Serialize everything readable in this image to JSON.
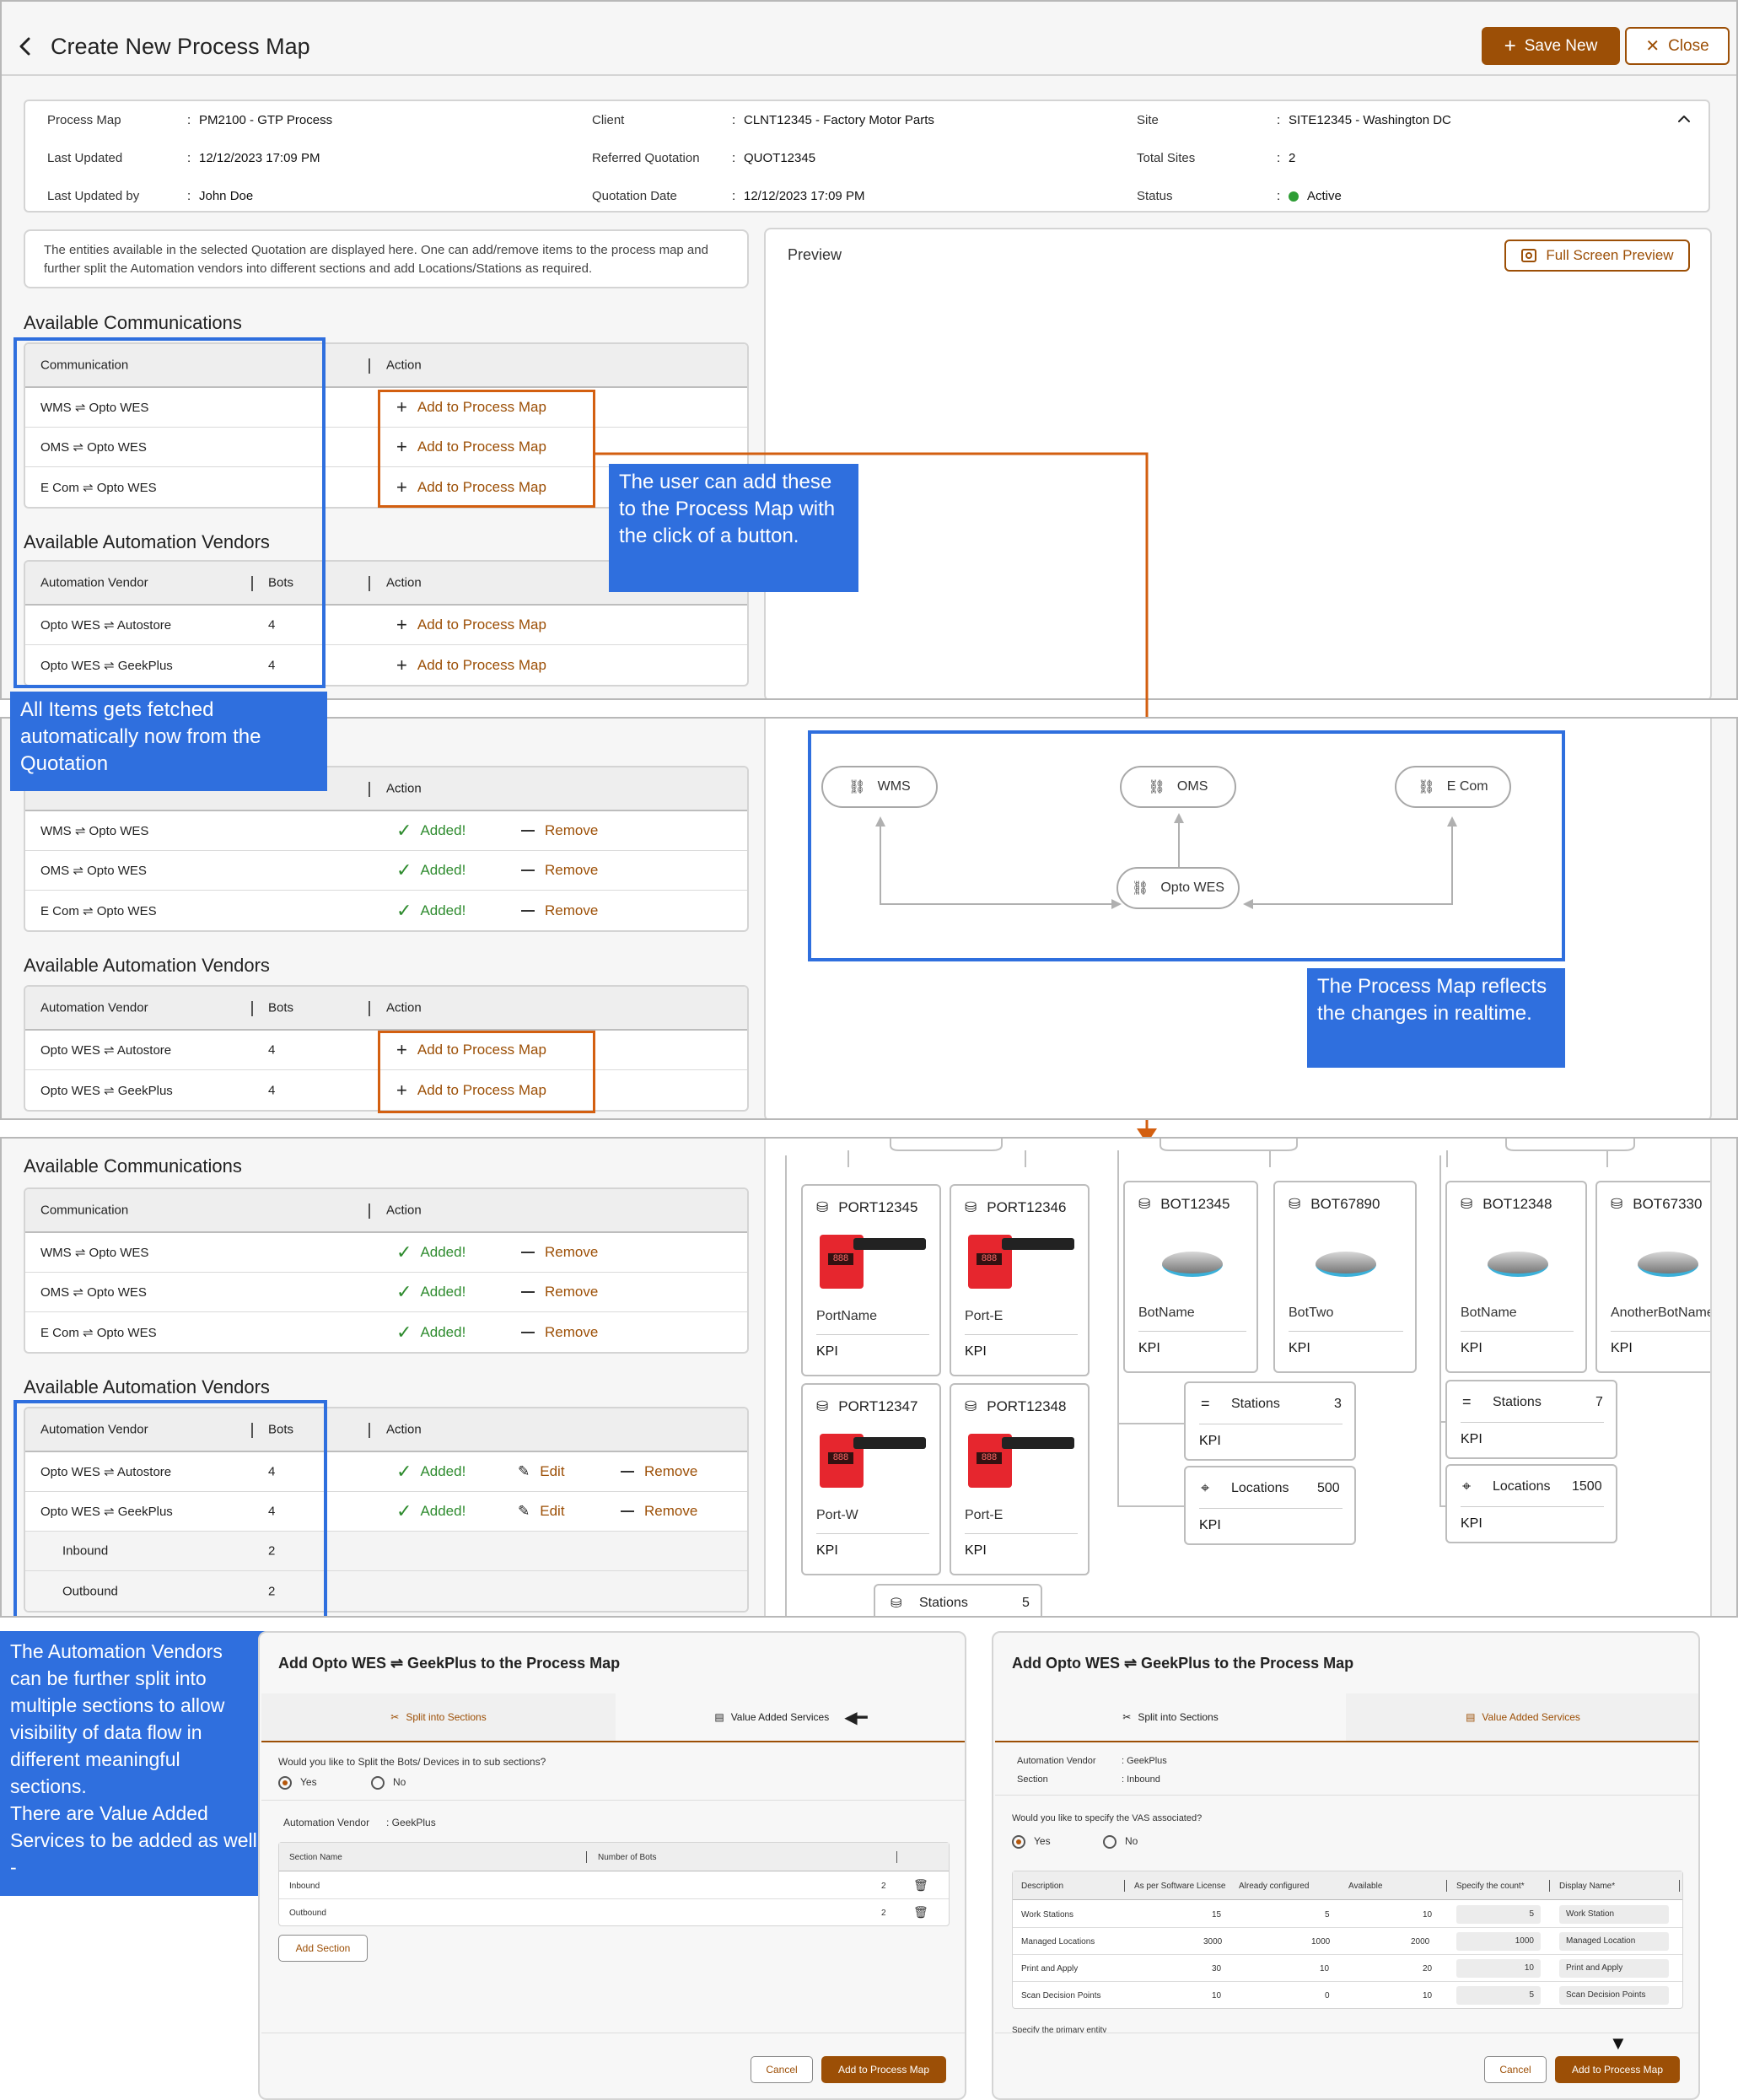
{
  "header": {
    "title": "Create New Process Map",
    "save_label": "Save New",
    "close_label": "Close"
  },
  "info": {
    "process_map_label": "Process Map",
    "process_map_value": "PM2100 - GTP Process",
    "last_updated_label": "Last Updated",
    "last_updated_value": "12/12/2023 17:09 PM",
    "last_updated_by_label": "Last Updated by",
    "last_updated_by_value": "John Doe",
    "client_label": "Client",
    "client_value": "CLNT12345 - Factory Motor Parts",
    "referred_quotation_label": "Referred Quotation",
    "referred_quotation_value": "QUOT12345",
    "quotation_date_label": "Quotation Date",
    "quotation_date_value": "12/12/2023 17:09 PM",
    "site_label": "Site",
    "site_value": "SITE12345 - Washington DC",
    "total_sites_label": "Total Sites",
    "total_sites_value": "2",
    "status_label": "Status",
    "status_value": "Active",
    "colon": ":"
  },
  "note": "The entities available in the selected Quotation are displayed here. One can add/remove items to the process map and further split the Automation vendors into different sections and add Locations/Stations as required.",
  "sections": {
    "available_communications": "Available Communications",
    "available_vendors": "Available Automation Vendors"
  },
  "table": {
    "communication_header": "Communication",
    "action_header": "Action",
    "vendor_header": "Automation Vendor",
    "bots_header": "Bots",
    "add_label": "Add to Process Map",
    "added_label": "Added!",
    "remove_label": "Remove",
    "edit_label": "Edit"
  },
  "communications": [
    "WMS ⇌ Opto WES",
    "OMS ⇌ Opto WES",
    "E Com ⇌ Opto WES"
  ],
  "vendors": [
    {
      "name": "Opto WES ⇌ Autostore",
      "bots": "4"
    },
    {
      "name": "Opto WES ⇌ GeekPlus",
      "bots": "4"
    }
  ],
  "subsections": [
    {
      "name": "Inbound",
      "bots": "2"
    },
    {
      "name": "Outbound",
      "bots": "2"
    }
  ],
  "preview": {
    "title": "Preview",
    "fullscreen_label": "Full Screen Preview"
  },
  "map_nodes": {
    "wms": "WMS",
    "oms": "OMS",
    "ecom": "E Com",
    "opto": "Opto WES"
  },
  "callouts": {
    "add_button": "The user can add these to the Process Map with the click of a button.",
    "fetched": "All Items gets fetched automatically now from the Quotation",
    "realtime": "The Process Map reflects the changes in realtime.",
    "split": "The Automation Vendors can be further split into multiple sections to allow visibility of data flow in different meaningful sections.\nThere are Value Added Services to be added as well -"
  },
  "ports": [
    {
      "id": "PORT12345",
      "name": "PortName",
      "kpi": "KPI",
      "display": "888"
    },
    {
      "id": "PORT12346",
      "name": "Port-E",
      "kpi": "KPI",
      "display": "888"
    },
    {
      "id": "PORT12347",
      "name": "Port-W",
      "kpi": "KPI",
      "display": "888"
    },
    {
      "id": "PORT12348",
      "name": "Port-E",
      "kpi": "KPI",
      "display": "888"
    }
  ],
  "bots_a": [
    {
      "id": "BOT12345",
      "name": "BotName",
      "kpi": "KPI"
    },
    {
      "id": "BOT67890",
      "name": "BotTwo",
      "kpi": "KPI"
    }
  ],
  "bots_b": [
    {
      "id": "BOT12348",
      "name": "BotName",
      "kpi": "KPI"
    },
    {
      "id": "BOT67330",
      "name": "AnotherBotName",
      "kpi": "KPI"
    }
  ],
  "stat_cards": {
    "stations_a": {
      "label": "Stations",
      "value": "3",
      "kpi": "KPI"
    },
    "locations_a": {
      "label": "Locations",
      "value": "500",
      "kpi": "KPI"
    },
    "stations_b": {
      "label": "Stations",
      "value": "7",
      "kpi": "KPI"
    },
    "locations_b": {
      "label": "Locations",
      "value": "1500",
      "kpi": "KPI"
    },
    "stations_c": {
      "label": "Stations",
      "value": "5"
    }
  },
  "dialog1": {
    "title": "Add Opto WES ⇌ GeekPlus to the Process Map",
    "tab_split": "Split into Sections",
    "tab_vas": "Value Added Services",
    "question": "Would you like to Split the Bots/ Devices in to sub sections?",
    "yes": "Yes",
    "no": "No",
    "vendor_label": "Automation Vendor",
    "vendor_value": ": GeekPlus",
    "col_section": "Section Name",
    "col_bots": "Number of Bots",
    "rows": [
      {
        "name": "Inbound",
        "bots": "2"
      },
      {
        "name": "Outbound",
        "bots": "2"
      }
    ],
    "add_section": "Add Section",
    "cancel": "Cancel",
    "submit": "Add to Process Map"
  },
  "dialog2": {
    "title": "Add Opto WES ⇌ GeekPlus to the Process Map",
    "tab_split": "Split into Sections",
    "tab_vas": "Value Added Services",
    "vendor_label": "Automation Vendor",
    "vendor_value": ": GeekPlus",
    "section_label": "Section",
    "section_value": ": Inbound",
    "question": "Would you like to specify the VAS associated?",
    "yes": "Yes",
    "no": "No",
    "cols": [
      "Description",
      "As per Software License",
      "Already configured",
      "Available",
      "Specify the count*",
      "Display Name*"
    ],
    "rows": [
      {
        "desc": "Work Stations",
        "license": "15",
        "configured": "5",
        "available": "10",
        "count": "5",
        "display": "Work Station"
      },
      {
        "desc": "Managed Locations",
        "license": "3000",
        "configured": "1000",
        "available": "2000",
        "count": "1000",
        "display": "Managed Location"
      },
      {
        "desc": "Print and Apply",
        "license": "30",
        "configured": "10",
        "available": "20",
        "count": "10",
        "display": "Print and Apply"
      },
      {
        "desc": "Scan Decision Points",
        "license": "10",
        "configured": "0",
        "available": "10",
        "count": "5",
        "display": "Scan Decision Points"
      }
    ],
    "footnote": "Specify the primary entity",
    "cancel": "Cancel",
    "submit": "Add to Process Map"
  },
  "colors": {
    "brand": "#9c4f06",
    "callout": "#2f6fde",
    "highlight": "#d35f10",
    "success": "#2e8b2e"
  }
}
